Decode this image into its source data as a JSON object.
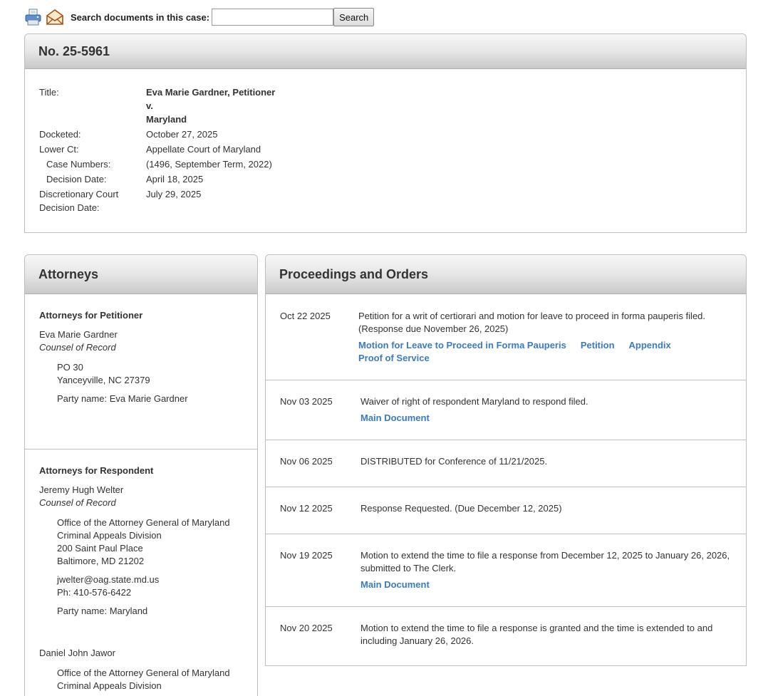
{
  "toolbar": {
    "print_icon": "printer-icon",
    "email_icon": "envelope-icon",
    "search_label": "Search documents in this case:",
    "search_value": "",
    "search_button": "Search"
  },
  "case": {
    "number": "No. 25-5961",
    "labels": {
      "title": "Title:",
      "docketed": "Docketed:",
      "lower_ct": "Lower Ct:",
      "case_numbers": "Case Numbers:",
      "decision_date": "Decision Date:",
      "disc_date_1": "Discretionary Court",
      "disc_date_2": "Decision Date:"
    },
    "title_line1": "Eva Marie Gardner, Petitioner",
    "title_line2": "v.",
    "title_line3": "Maryland",
    "docketed": "October 27, 2025",
    "lower_ct": "Appellate Court of Maryland",
    "case_numbers": "(1496, September Term, 2022)",
    "decision_date": "April 18, 2025",
    "discretionary_date": "July 29, 2025"
  },
  "attorneys": {
    "heading": "Attorneys",
    "petitioner": {
      "heading": "Attorneys for Petitioner",
      "name": "Eva Marie Gardner",
      "role": "Counsel of Record",
      "addr1": "PO 30",
      "addr2": "Yanceyville, NC 27379",
      "party": "Party name: Eva Marie Gardner"
    },
    "respondent": {
      "heading": "Attorneys for Respondent",
      "name": "Jeremy Hugh Welter",
      "role": "Counsel of Record",
      "addr1": "Office of the Attorney General of Maryland",
      "addr2": "Criminal Appeals Division",
      "addr3": "200 Saint Paul Place",
      "addr4": "Baltimore, MD 21202",
      "email": "jwelter@oag.state.md.us",
      "phone": "Ph: 410-576-6422",
      "party": "Party name: Maryland",
      "second_name": "Daniel John Jawor",
      "second_addr1": "Office of the Attorney General of Maryland",
      "second_addr2": "Criminal Appeals Division"
    }
  },
  "proceedings": {
    "heading": "Proceedings and Orders",
    "entries": [
      {
        "date": "Oct 22 2025",
        "text": "Petition for a writ of certiorari and motion for leave to proceed in forma pauperis filed. (Response due November 26, 2025)",
        "links": [
          "Motion for Leave to Proceed in Forma Pauperis",
          "Petition",
          "Appendix",
          "Proof of Service"
        ]
      },
      {
        "date": "Nov 03 2025",
        "text": "Waiver of right of respondent Maryland to respond filed.",
        "links": [
          "Main Document"
        ]
      },
      {
        "date": "Nov 06 2025",
        "text": "DISTRIBUTED for Conference of 11/21/2025.",
        "links": []
      },
      {
        "date": "Nov 12 2025",
        "text": "Response Requested. (Due December 12, 2025)",
        "links": []
      },
      {
        "date": "Nov 19 2025",
        "text": "Motion to extend the time to file a response from December 12, 2025 to January 26, 2026, submitted to The Clerk.",
        "links": [
          "Main Document"
        ]
      },
      {
        "date": "Nov 20 2025",
        "text": "Motion to extend the time to file a response is granted and the time is extended to and including January 26, 2026.",
        "links": []
      }
    ]
  }
}
